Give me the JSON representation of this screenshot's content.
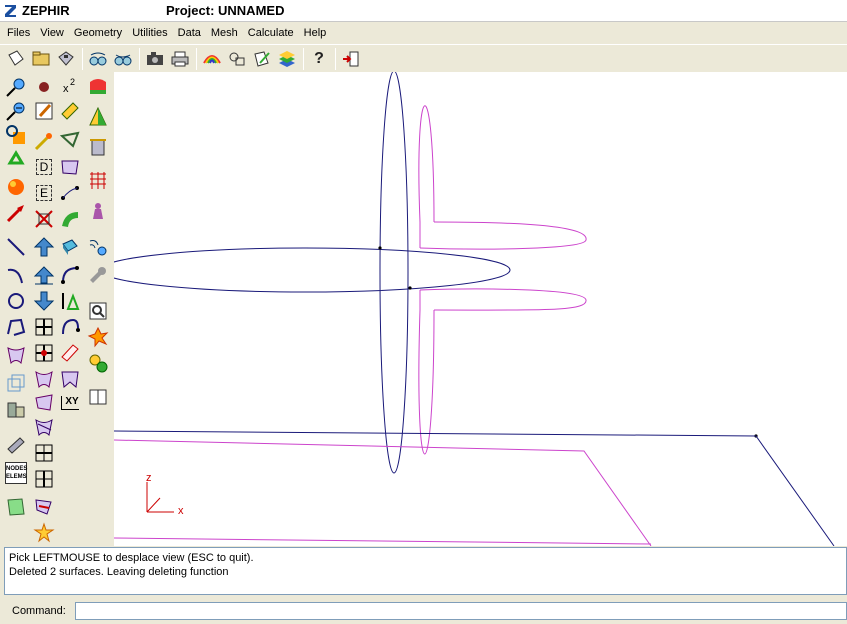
{
  "window": {
    "app_name": "ZEPHIR",
    "project_title": "Project: UNNAMED"
  },
  "menu": {
    "items": [
      "Files",
      "View",
      "Geometry",
      "Utilities",
      "Data",
      "Mesh",
      "Calculate",
      "Help"
    ]
  },
  "toolbar": {
    "buttons": [
      {
        "icon": "new-file-icon"
      },
      {
        "icon": "open-folder-icon"
      },
      {
        "icon": "save-disk-icon"
      },
      {
        "icon": "zoom-glasses-icon"
      },
      {
        "icon": "zoom-glasses-alt-icon"
      },
      {
        "icon": "camera-icon"
      },
      {
        "icon": "printer-icon"
      },
      {
        "icon": "rainbow-render-icon"
      },
      {
        "icon": "shapes-icon"
      },
      {
        "icon": "edit-notes-icon"
      },
      {
        "icon": "layers-icon"
      },
      {
        "icon": "help-question-icon"
      },
      {
        "icon": "exit-door-icon"
      }
    ],
    "help_glyph": "?"
  },
  "palette": {
    "labels": {
      "r_label": "D",
      "e_label": "E",
      "xy_label": "XY",
      "nodes_label_1": "NODES",
      "nodes_label_2": "ELEMS"
    }
  },
  "viewport": {
    "axis": {
      "z_label": "z",
      "x_label": "x"
    },
    "colors": {
      "navy": "#1a1a7a",
      "magenta": "#cc44cc",
      "axis_red": "#cc0000"
    }
  },
  "messages": {
    "line1": "Pick LEFTMOUSE to desplace view (ESC to quit).",
    "line2": "Deleted 2 surfaces. Leaving deleting function"
  },
  "command": {
    "label": "Command:",
    "value": ""
  }
}
